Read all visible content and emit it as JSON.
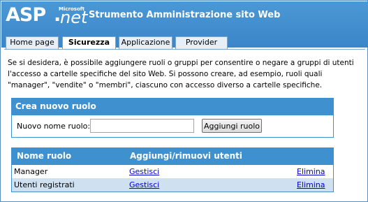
{
  "header": {
    "logo_asp": "ASP",
    "logo_microsoft": "Microsoft",
    "logo_dot": ".",
    "logo_net": "net",
    "title": "Strumento Amministrazione sito Web"
  },
  "tabs": [
    {
      "label": "Home page",
      "active": false
    },
    {
      "label": "Sicurezza",
      "active": true
    },
    {
      "label": "Applicazione",
      "active": false
    },
    {
      "label": "Provider",
      "active": false
    }
  ],
  "intro_text": "Se si desidera, è possibile aggiungere ruoli o gruppi per consentire o negare a gruppi di utenti l'accesso a cartelle specifiche del sito Web. Si possono creare, ad esempio, ruoli quali \"manager\", \"vendite\" o \"membri\", ciascuno con accesso diverso a cartelle specifiche.",
  "create_role": {
    "heading": "Crea nuovo ruolo",
    "label": "Nuovo nome ruolo:",
    "value": "",
    "button": "Aggiungi ruolo"
  },
  "roles_table": {
    "col_name": "Nome ruolo",
    "col_manage": "Aggiungi/rimuovi utenti",
    "rows": [
      {
        "name": "Manager",
        "manage": "Gestisci",
        "delete": "Elimina"
      },
      {
        "name": "Utenti registrati",
        "manage": "Gestisci",
        "delete": "Elimina"
      }
    ]
  },
  "colors": {
    "header_blue": "#3f90cf",
    "alt_row": "#cfe0f1",
    "link": "#0000cc"
  }
}
